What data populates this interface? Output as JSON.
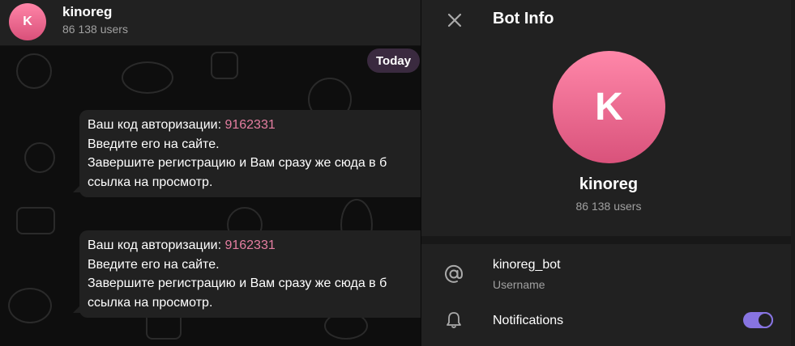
{
  "chat": {
    "avatar_letter": "K",
    "title": "kinoreg",
    "subtitle": "86 138 users",
    "date_pill": "Today",
    "messages": [
      {
        "line1_prefix": "Ваш код авторизации: ",
        "code": "9162331",
        "line2": "Введите его на сайте.",
        "line3": "Завершите регистрацию и Вам сразу же сюда в б",
        "line4": "ссылка на просмотр."
      },
      {
        "line1_prefix": "Ваш код авторизации: ",
        "code": "9162331",
        "line2": "Введите его на сайте.",
        "line3": "Завершите регистрацию и Вам сразу же сюда в б",
        "line4": "ссылка на просмотр."
      }
    ]
  },
  "panel": {
    "close_icon": "close-icon",
    "title": "Bot Info",
    "avatar_letter": "K",
    "name": "kinoreg",
    "subtitle": "86 138 users",
    "username_row": {
      "icon": "at-icon",
      "value": "kinoreg_bot",
      "label": "Username"
    },
    "notifications_row": {
      "icon": "bell-icon",
      "label": "Notifications",
      "enabled": true
    }
  },
  "colors": {
    "accent": "#8774e1",
    "avatar_gradient_top": "#ff87a9",
    "avatar_gradient_bottom": "#d9527b",
    "code_link": "#e57ea1",
    "bubble": "#212121",
    "panel": "#212121"
  }
}
